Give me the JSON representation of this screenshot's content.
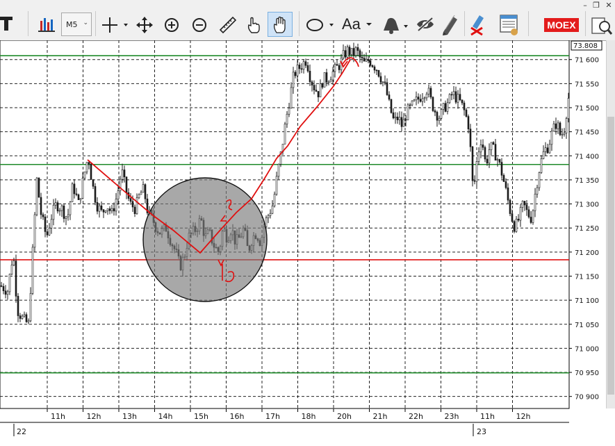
{
  "toolbar": {
    "timeframe": "M5",
    "text_tool_label": "Aa",
    "exchange_label": "MOEX",
    "window_controls": [
      "–",
      "❐",
      "✕"
    ],
    "icons": [
      "text-tool-icon",
      "bar-chart-icon",
      "crosshair-icon",
      "move-icon",
      "zoom-in-icon",
      "zoom-out-icon",
      "ruler-icon",
      "hand-pointer-icon",
      "hand-pan-icon",
      "ellipse-tool-icon",
      "text-aa-icon",
      "bell-icon",
      "eye-slash-icon",
      "pencil-icon",
      "delete-drawings-icon",
      "order-book-icon",
      "exchange-badge",
      "print-preview-icon"
    ]
  },
  "colors": {
    "grid": "#202020",
    "candle": "#1a1a1a",
    "green_line": "#1f8a2a",
    "red_line": "#e01010",
    "ellipse_fill": "#7a7a7a",
    "annotation": "#e01010"
  },
  "chart_data": {
    "type": "candlestick",
    "symbol_timeframe": "M5",
    "current_price_label": "73.808",
    "y_ticks": [
      "71 600",
      "71 550",
      "71 500",
      "71 450",
      "71 400",
      "71 350",
      "71 300",
      "71 250",
      "71 200",
      "71 150",
      "71 100",
      "71 050",
      "71 000",
      "70 950",
      "70 900"
    ],
    "y_tick_values": [
      71600,
      71550,
      71500,
      71450,
      71400,
      71350,
      71300,
      71250,
      71200,
      71150,
      71100,
      71050,
      71000,
      70950,
      70900
    ],
    "ylim": [
      70875,
      71640
    ],
    "x_tick_labels": [
      "11h",
      "12h",
      "13h",
      "14h",
      "15h",
      "16h",
      "17h",
      "18h",
      "20h",
      "21h",
      "22h",
      "23h",
      "11h",
      "12h"
    ],
    "date_labels": [
      "22",
      "23"
    ],
    "horizontal_lines": [
      {
        "price": 71608,
        "color": "green"
      },
      {
        "price": 71382,
        "color": "green"
      },
      {
        "price": 71184,
        "color": "red"
      },
      {
        "price": 70949,
        "color": "green"
      }
    ],
    "price_path": [
      [
        0,
        71130
      ],
      [
        10,
        71120
      ],
      [
        18,
        71200
      ],
      [
        24,
        71080
      ],
      [
        32,
        71060
      ],
      [
        40,
        71050
      ],
      [
        46,
        71200
      ],
      [
        52,
        71350
      ],
      [
        58,
        71280
      ],
      [
        66,
        71230
      ],
      [
        72,
        71270
      ],
      [
        80,
        71300
      ],
      [
        88,
        71290
      ],
      [
        96,
        71270
      ],
      [
        104,
        71340
      ],
      [
        112,
        71300
      ],
      [
        120,
        71360
      ],
      [
        126,
        71400
      ],
      [
        132,
        71340
      ],
      [
        138,
        71300
      ],
      [
        146,
        71280
      ],
      [
        152,
        71300
      ],
      [
        160,
        71280
      ],
      [
        168,
        71320
      ],
      [
        174,
        71370
      ],
      [
        180,
        71330
      ],
      [
        186,
        71300
      ],
      [
        194,
        71290
      ],
      [
        200,
        71320
      ],
      [
        206,
        71330
      ],
      [
        212,
        71280
      ],
      [
        218,
        71270
      ],
      [
        224,
        71250
      ],
      [
        230,
        71240
      ],
      [
        238,
        71250
      ],
      [
        246,
        71220
      ],
      [
        252,
        71200
      ],
      [
        258,
        71170
      ],
      [
        264,
        71190
      ],
      [
        270,
        71230
      ],
      [
        276,
        71240
      ],
      [
        282,
        71250
      ],
      [
        288,
        71270
      ],
      [
        294,
        71230
      ],
      [
        300,
        71240
      ],
      [
        308,
        71210
      ],
      [
        314,
        71200
      ],
      [
        320,
        71250
      ],
      [
        326,
        71230
      ],
      [
        332,
        71250
      ],
      [
        338,
        71220
      ],
      [
        344,
        71230
      ],
      [
        350,
        71250
      ],
      [
        356,
        71200
      ],
      [
        362,
        71230
      ],
      [
        368,
        71240
      ],
      [
        374,
        71220
      ],
      [
        380,
        71260
      ],
      [
        386,
        71280
      ],
      [
        392,
        71300
      ],
      [
        398,
        71360
      ],
      [
        404,
        71410
      ],
      [
        410,
        71470
      ],
      [
        416,
        71520
      ],
      [
        422,
        71570
      ],
      [
        428,
        71580
      ],
      [
        434,
        71590
      ],
      [
        440,
        71600
      ],
      [
        446,
        71560
      ],
      [
        452,
        71540
      ],
      [
        458,
        71530
      ],
      [
        464,
        71560
      ],
      [
        470,
        71560
      ],
      [
        476,
        71570
      ],
      [
        482,
        71580
      ],
      [
        488,
        71590
      ],
      [
        494,
        71610
      ],
      [
        500,
        71620
      ],
      [
        506,
        71610
      ],
      [
        512,
        71620
      ],
      [
        518,
        71600
      ],
      [
        524,
        71590
      ],
      [
        530,
        71600
      ],
      [
        536,
        71590
      ],
      [
        542,
        71580
      ],
      [
        548,
        71560
      ],
      [
        554,
        71540
      ],
      [
        560,
        71500
      ],
      [
        566,
        71470
      ],
      [
        572,
        71480
      ],
      [
        578,
        71460
      ],
      [
        584,
        71490
      ],
      [
        590,
        71500
      ],
      [
        596,
        71510
      ],
      [
        602,
        71520
      ],
      [
        608,
        71530
      ],
      [
        614,
        71540
      ],
      [
        620,
        71510
      ],
      [
        626,
        71490
      ],
      [
        632,
        71480
      ],
      [
        638,
        71500
      ],
      [
        644,
        71510
      ],
      [
        650,
        71530
      ],
      [
        656,
        71520
      ],
      [
        662,
        71510
      ],
      [
        668,
        71490
      ],
      [
        674,
        71460
      ],
      [
        680,
        71320
      ],
      [
        686,
        71400
      ],
      [
        692,
        71440
      ],
      [
        698,
        71380
      ],
      [
        704,
        71420
      ],
      [
        710,
        71410
      ],
      [
        716,
        71390
      ],
      [
        722,
        71360
      ],
      [
        728,
        71320
      ],
      [
        734,
        71280
      ],
      [
        740,
        71250
      ],
      [
        746,
        71270
      ],
      [
        752,
        71300
      ],
      [
        758,
        71280
      ],
      [
        764,
        71270
      ],
      [
        770,
        71330
      ],
      [
        776,
        71380
      ],
      [
        782,
        71410
      ],
      [
        788,
        71420
      ],
      [
        794,
        71450
      ],
      [
        800,
        71470
      ],
      [
        806,
        71440
      ],
      [
        812,
        71460
      ],
      [
        816,
        71520
      ]
    ]
  }
}
